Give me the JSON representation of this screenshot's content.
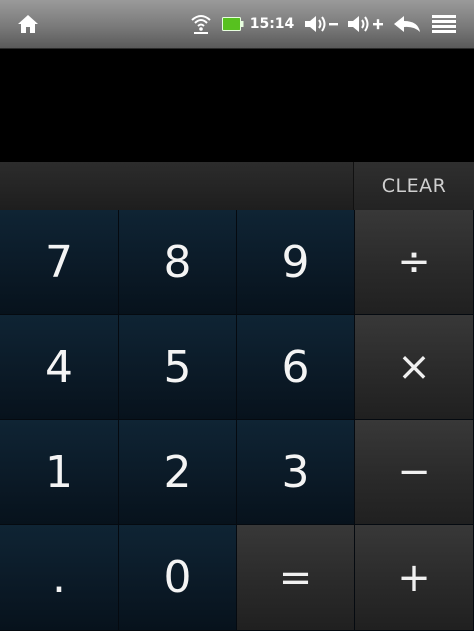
{
  "status_bar": {
    "time": "15:14",
    "icons": [
      "home-icon",
      "wifi-icon",
      "battery-icon",
      "volume-down-icon",
      "volume-up-icon",
      "back-icon",
      "menu-icon"
    ]
  },
  "display": {
    "value": ""
  },
  "clear_label": "CLEAR",
  "keys": {
    "k7": "7",
    "k8": "8",
    "k9": "9",
    "div": "÷",
    "k4": "4",
    "k5": "5",
    "k6": "6",
    "mul": "×",
    "k1": "1",
    "k2": "2",
    "k3": "3",
    "sub": "−",
    "dot": ".",
    "k0": "0",
    "eq": "=",
    "add": "+"
  },
  "colors": {
    "number_key": "#0d1e2c",
    "operator_key": "#2c2c2c",
    "status_bar": "#8a8a8a"
  }
}
